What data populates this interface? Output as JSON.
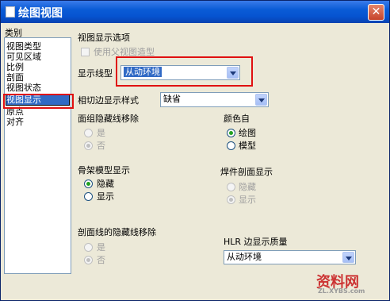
{
  "window": {
    "title": "绘图视图",
    "close_symbol": "✕"
  },
  "categories": {
    "header": "类别",
    "items": [
      "视图类型",
      "可见区域",
      "比例",
      "剖面",
      "视图状态",
      "视图显示",
      "原点",
      "对齐"
    ],
    "selected": "视图显示"
  },
  "view_display": {
    "group_label": "视图显示选项",
    "use_parent_label": "使用父视图造型",
    "display_style_label": "显示线型",
    "display_style_value": "从动环境",
    "tangent_style_label": "相切边显示样式",
    "tangent_style_value": "缺省"
  },
  "face_group_hidden": {
    "label": "面组隐藏线移除",
    "options": [
      "是",
      "否"
    ],
    "selected": "否"
  },
  "color_from": {
    "label": "颜色自",
    "options": [
      "绘图",
      "模型"
    ],
    "selected": "绘图"
  },
  "skeleton": {
    "label": "骨架模型显示",
    "options": [
      "隐藏",
      "显示"
    ],
    "selected": "隐藏"
  },
  "weld_section": {
    "label": "焊件剖面显示",
    "options": [
      "隐藏",
      "显示"
    ],
    "selected": "显示"
  },
  "section_hidden": {
    "label": "剖面线的隐藏线移除",
    "options": [
      "是",
      "否"
    ],
    "selected": "否"
  },
  "hlr_quality": {
    "label": "HLR 边显示质量",
    "value": "从动环境"
  },
  "watermark": {
    "text": "资料网",
    "sub": "ZL.XYBS.com"
  }
}
